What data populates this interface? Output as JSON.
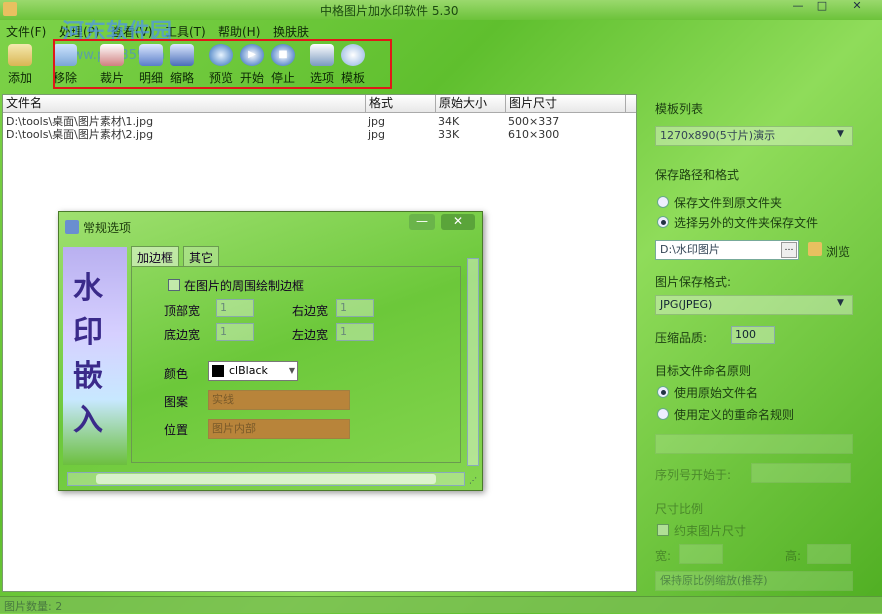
{
  "window": {
    "title": "中格图片加水印软件 5.30"
  },
  "watermark": {
    "text": "河东软件园",
    "url": "www.pc0359.cn"
  },
  "menu": [
    "文件(F)",
    "处理(P)",
    "查看(V)",
    "工具(T)",
    "帮助(H)",
    "换肤肤"
  ],
  "toolbar": {
    "add": "添加",
    "remove": "移除",
    "crop": "裁片",
    "detail": "明细",
    "thumb": "缩略",
    "preview": "预览",
    "start": "开始",
    "stop": "停止",
    "options": "选项",
    "template": "模板"
  },
  "filelist": {
    "headers": [
      "文件名",
      "格式",
      "原始大小",
      "图片尺寸"
    ],
    "rows": [
      [
        "D:\\tools\\桌面\\图片素材\\1.jpg",
        "jpg",
        "34K",
        "500×337"
      ],
      [
        "D:\\tools\\桌面\\图片素材\\2.jpg",
        "jpg",
        "33K",
        "610×300"
      ]
    ]
  },
  "right": {
    "template_list_label": "模板列表",
    "template_value": "1270x890(5寸片)演示",
    "save_path_label": "保存路径和格式",
    "radio_same_folder": "保存文件到原文件夹",
    "radio_other_folder": "选择另外的文件夹保存文件",
    "folder_value": "D:\\水印图片",
    "browse": "浏览",
    "format_label": "图片保存格式:",
    "format_value": "JPG(JPEG)",
    "quality_label": "压缩品质:",
    "quality_value": "100",
    "naming_label": "目标文件命名原则",
    "naming_original": "使用原始文件名",
    "naming_custom": "使用定义的重命名规则",
    "seq_label": "序列号开始于:",
    "size_label": "尺寸比例",
    "constrain": "约束图片尺寸",
    "width_label": "宽:",
    "height_label": "高:",
    "scale_mode": "保持原比例缩放(推荐)"
  },
  "status": {
    "text": "图片数量: 2"
  },
  "dialog": {
    "title": "常规选项",
    "side_chars": [
      "水",
      "印",
      "嵌",
      "入"
    ],
    "tabs": [
      "加边框",
      "其它"
    ],
    "checkbox": "在图片的周围绘制边框",
    "top_width": "顶部宽",
    "right_width": "右边宽",
    "bottom_width": "底边宽",
    "left_width": "左边宽",
    "spin_value": "1",
    "color_label": "颜色",
    "color_value": "clBlack",
    "pattern_label": "图案",
    "pattern_value": "实线",
    "position_label": "位置",
    "position_value": "图片内部"
  },
  "colors": {
    "accent_red": "#e01818",
    "panel_green": "#6cc23a"
  }
}
